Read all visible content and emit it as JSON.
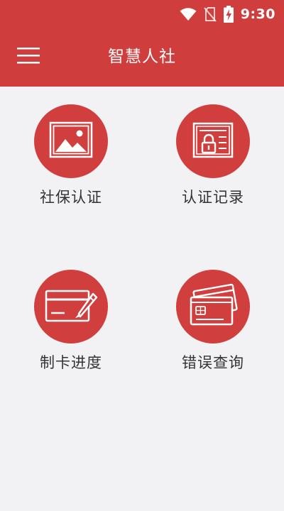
{
  "status_bar": {
    "time": "9:30",
    "icons": [
      "wifi-icon",
      "no-sim-icon",
      "battery-charging-icon"
    ]
  },
  "header": {
    "title": "智慧人社",
    "menu_icon": "hamburger-menu-icon",
    "background_color": "#cf3d3c"
  },
  "grid": {
    "circle_color": "#d03f3d",
    "items": [
      {
        "label": "社保认证",
        "icon": "picture-icon"
      },
      {
        "label": "认证记录",
        "icon": "locked-document-icon"
      },
      {
        "label": "制卡进度",
        "icon": "card-pencil-icon"
      },
      {
        "label": "错误查询",
        "icon": "cards-icon"
      }
    ]
  }
}
